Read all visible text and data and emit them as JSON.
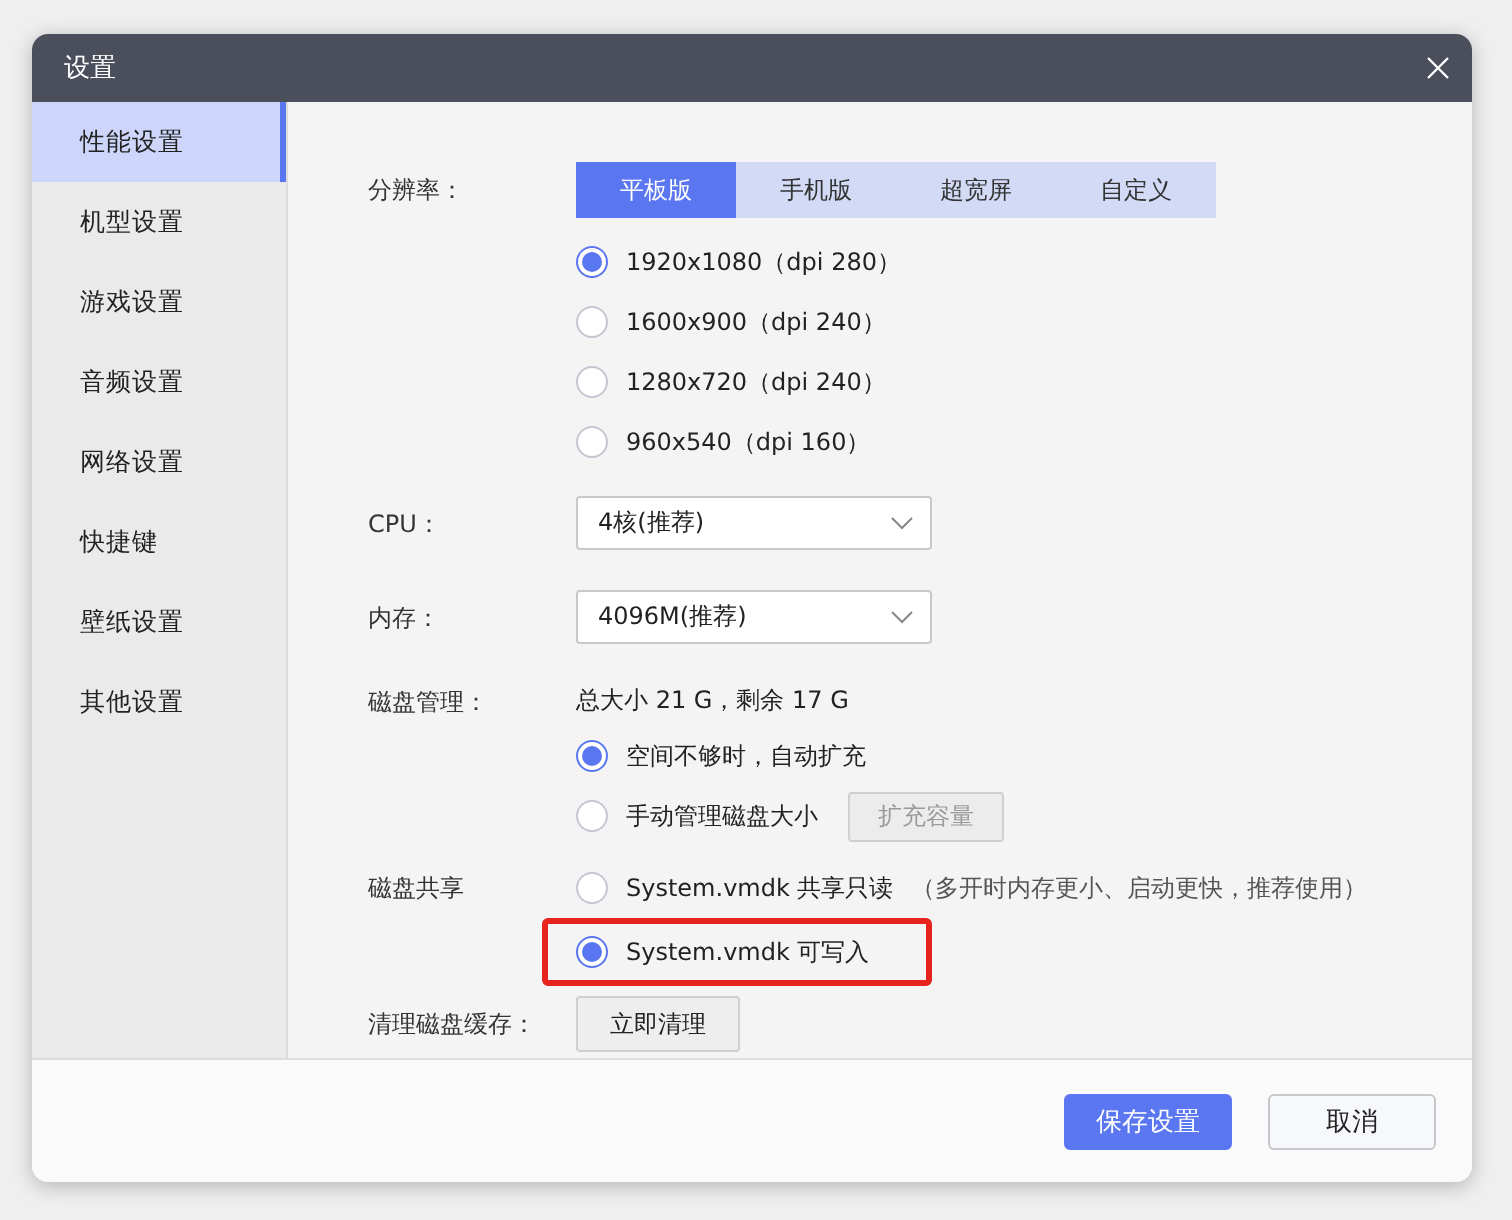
{
  "window": {
    "title": "设置"
  },
  "sidebar": {
    "items": [
      {
        "label": "性能设置",
        "selected": true
      },
      {
        "label": "机型设置",
        "selected": false
      },
      {
        "label": "游戏设置",
        "selected": false
      },
      {
        "label": "音频设置",
        "selected": false
      },
      {
        "label": "网络设置",
        "selected": false
      },
      {
        "label": "快捷键",
        "selected": false
      },
      {
        "label": "壁纸设置",
        "selected": false
      },
      {
        "label": "其他设置",
        "selected": false
      }
    ]
  },
  "resolution": {
    "label": "分辨率：",
    "tabs": [
      {
        "label": "平板版",
        "selected": true
      },
      {
        "label": "手机版",
        "selected": false
      },
      {
        "label": "超宽屏",
        "selected": false
      },
      {
        "label": "自定义",
        "selected": false
      }
    ],
    "options": [
      {
        "label": "1920x1080（dpi 280）",
        "selected": true
      },
      {
        "label": "1600x900（dpi 240）",
        "selected": false
      },
      {
        "label": "1280x720（dpi 240）",
        "selected": false
      },
      {
        "label": "960x540（dpi 160）",
        "selected": false
      }
    ]
  },
  "cpu": {
    "label": "CPU：",
    "value": "4核(推荐)"
  },
  "memory": {
    "label": "内存：",
    "value": "4096M(推荐)"
  },
  "disk": {
    "label": "磁盘管理：",
    "summary": "总大小 21 G，剩余 17 G",
    "options": [
      {
        "label": "空间不够时，自动扩充",
        "selected": true
      },
      {
        "label": "手动管理磁盘大小",
        "selected": false
      }
    ],
    "expand_button": {
      "label": "扩充容量",
      "disabled": true
    }
  },
  "disk_share": {
    "label": "磁盘共享",
    "options": [
      {
        "label": "System.vmdk 共享只读",
        "note": "（多开时内存更小、启动更快，推荐使用）",
        "selected": false,
        "highlighted": false
      },
      {
        "label": "System.vmdk 可写入",
        "selected": true,
        "highlighted": true
      }
    ]
  },
  "cache": {
    "label": "清理磁盘缓存：",
    "button": "立即清理"
  },
  "footer": {
    "buttons": [
      {
        "label": "保存设置",
        "kind": "primary"
      },
      {
        "label": "取消",
        "kind": "secondary"
      }
    ]
  }
}
